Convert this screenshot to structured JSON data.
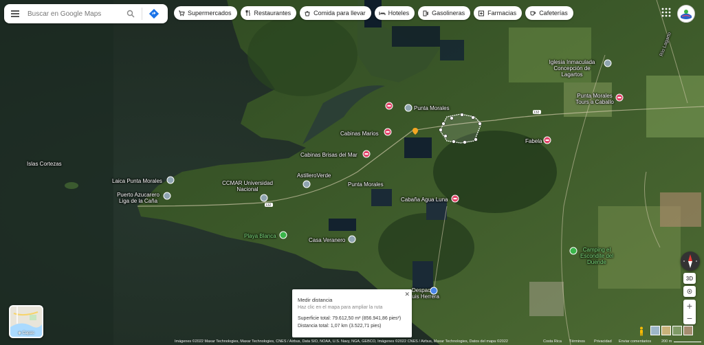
{
  "search": {
    "placeholder": "Buscar en Google Maps"
  },
  "chips": [
    {
      "label": "Supermercados",
      "icon": "cart-icon"
    },
    {
      "label": "Restaurantes",
      "icon": "fork-knife-icon"
    },
    {
      "label": "Comida para llevar",
      "icon": "takeout-icon"
    },
    {
      "label": "Hoteles",
      "icon": "bed-icon"
    },
    {
      "label": "Gasolineras",
      "icon": "gas-pump-icon"
    },
    {
      "label": "Farmacias",
      "icon": "pharmacy-icon"
    },
    {
      "label": "Cafeterías",
      "icon": "coffee-icon"
    }
  ],
  "places": {
    "punta_morales": "Punta Morales",
    "punta_morales_2": "Punta Morales",
    "cabinas_marios": "Cabinas Marios",
    "cabinas_brisas": "Cabinas Brisas del Mar",
    "astillero": "AstilleroVerde",
    "cabana": "Cabaña Agua Luna",
    "fabela": "Fabela",
    "iglesia": "Iglesia Inmaculada Concepción de Lagartos",
    "tours": "Punta Morales Tours a Caballo",
    "islas": "Islas Cortezas",
    "laica": "Laica Punta Morales",
    "puerto": "Puerto Azucarero Liga de la Caña",
    "ccmar": "CCMAR Universidad Nacional",
    "playa": "Playa Blanca",
    "casa": "Casa Veranero",
    "despacho": "Despacho Luis Herrera",
    "camping": "Camping el Escondite del Duende",
    "road_132": "132",
    "road_132b": "132",
    "rio": "Río Lagarto"
  },
  "measure": {
    "title": "Medir distancia",
    "hint": "Haz clic en el mapa para ampliar la ruta",
    "area": "Superficie total: 79.612,50 m² (856.941,86 pies²)",
    "distance": "Distancia total: 1,07 km (3.522,71 pies)"
  },
  "layers_label": "Capas",
  "controls": {
    "three_d": "3D"
  },
  "footer": {
    "attribution": "Imágenes ©2022 Maxar Technologies, Maxar Technologies, CNES / Airbus, Data SIO, NOAA, U.S. Navy, NGA, GEBCO, Imágenes ©2022 CNES / Airbus, Maxar Technologies, Datos del mapa ©2022",
    "country": "Costa Rica",
    "terms": "Términos",
    "privacy": "Privacidad",
    "feedback": "Enviar comentarios",
    "scale": "200 m"
  },
  "colors": {
    "pin_red": "#e2466b",
    "pin_gray": "#8fa4b0",
    "pin_green": "#3ab54a",
    "pin_orange": "#f5a623",
    "pin_blue": "#4a86e8"
  }
}
